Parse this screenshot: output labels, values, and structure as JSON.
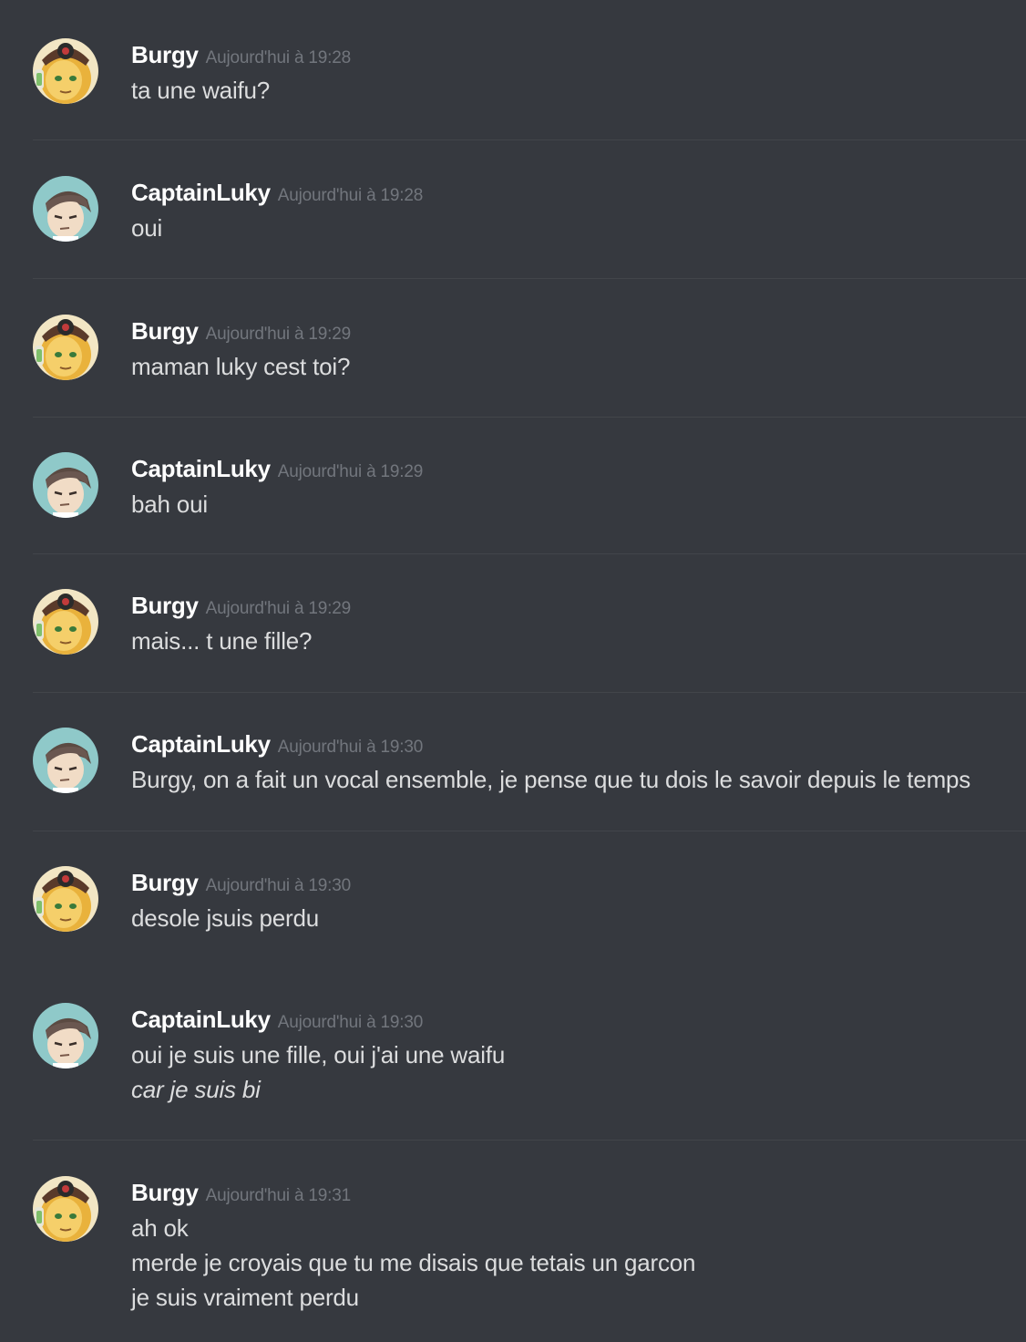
{
  "colors": {
    "background": "#36393f",
    "username": "#ffffff",
    "timestamp": "#72767d",
    "message_text": "#dcddde",
    "divider": "#42454a"
  },
  "messages": [
    {
      "author": "Burgy",
      "avatar": "burgy-avatar",
      "timestamp": "Aujourd'hui à 19:28",
      "lines": [
        "ta une waifu?"
      ]
    },
    {
      "author": "CaptainLuky",
      "avatar": "captainluky-avatar",
      "timestamp": "Aujourd'hui à 19:28",
      "lines": [
        "oui"
      ]
    },
    {
      "author": "Burgy",
      "avatar": "burgy-avatar",
      "timestamp": "Aujourd'hui à 19:29",
      "lines": [
        "maman luky cest toi?"
      ]
    },
    {
      "author": "CaptainLuky",
      "avatar": "captainluky-avatar",
      "timestamp": "Aujourd'hui à 19:29",
      "lines": [
        "bah oui"
      ]
    },
    {
      "author": "Burgy",
      "avatar": "burgy-avatar",
      "timestamp": "Aujourd'hui à 19:29",
      "lines": [
        "mais... t une fille?"
      ]
    },
    {
      "author": "CaptainLuky",
      "avatar": "captainluky-avatar",
      "timestamp": "Aujourd'hui à 19:30",
      "lines": [
        "Burgy, on a fait un vocal ensemble, je pense que tu dois le savoir depuis le temps"
      ]
    },
    {
      "author": "Burgy",
      "avatar": "burgy-avatar",
      "timestamp": "Aujourd'hui à 19:30",
      "lines": [
        "desole jsuis perdu"
      ]
    },
    {
      "author": "CaptainLuky",
      "avatar": "captainluky-avatar",
      "timestamp": "Aujourd'hui à 19:30",
      "lines": [
        "oui je suis une fille, oui j'ai une waifu",
        "car je suis bi"
      ]
    },
    {
      "author": "Burgy",
      "avatar": "burgy-avatar",
      "timestamp": "Aujourd'hui à 19:31",
      "lines": [
        "ah ok",
        "merde je croyais que tu me disais que tetais un garcon",
        "je suis vraiment perdu"
      ]
    }
  ]
}
